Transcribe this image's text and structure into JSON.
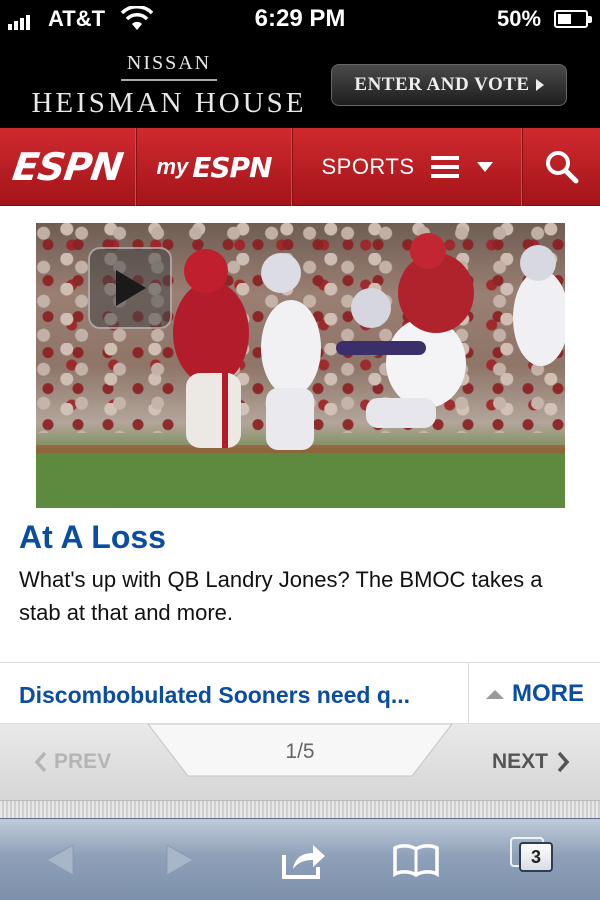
{
  "status_bar": {
    "carrier": "AT&T",
    "time": "6:29 PM",
    "battery": "50%",
    "battery_level": 0.5,
    "icons": [
      "signal-icon",
      "wifi-icon",
      "battery-icon"
    ]
  },
  "ad": {
    "brand_small": "NISSAN",
    "brand_large": "HEISMAN HOUSE",
    "cta_label": "ENTER AND VOTE"
  },
  "nav": {
    "logo": "ESPN",
    "my_prefix": "my",
    "my_logo": "ESPN",
    "sports_label": "SPORTS",
    "icons": [
      "menu-icon",
      "chevron-down-icon",
      "search-icon"
    ]
  },
  "article": {
    "headline": "At A Loss",
    "summary": "What's up with QB Landry Jones? The BMOC takes a stab at that and more."
  },
  "more_row": {
    "link_text": "Discombobulated Sooners need q...",
    "more_label": "MORE"
  },
  "pager": {
    "prev_label": "PREV",
    "next_label": "NEXT",
    "current": 1,
    "total": 5,
    "page_indicator": "1/5"
  },
  "toolbar": {
    "tabs_count": "3",
    "icons": [
      "back-icon",
      "forward-icon",
      "share-icon",
      "bookmarks-icon",
      "tabs-icon"
    ]
  },
  "colors": {
    "espn_red": "#c0191f",
    "link_blue": "#0b4da2",
    "toolbar_blue": "#8fa1b9"
  }
}
